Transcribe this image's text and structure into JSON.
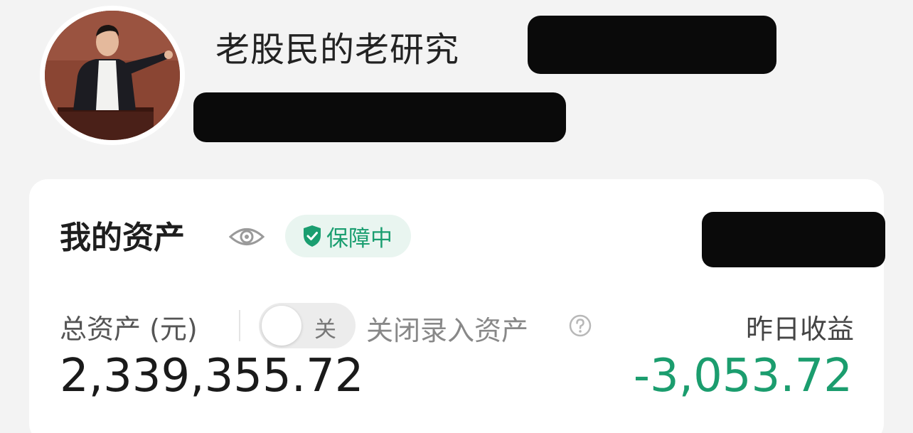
{
  "profile": {
    "username": "老股民的老研究"
  },
  "assets": {
    "title": "我的资产",
    "badge_label": "保障中",
    "total_label": "总资产 (元)",
    "toggle_label": "关",
    "toggle_state": "off",
    "close_entry_label": "关闭录入资产",
    "yesterday_label": "昨日收益",
    "total_value": "2,339,355.72",
    "yesterday_value": "-3,053.72"
  },
  "icons": {
    "eye": "eye-icon",
    "shield": "shield-check-icon",
    "help": "question-circle-icon"
  },
  "colors": {
    "accent_green": "#1a9e70",
    "badge_background": "#e9f5f0",
    "loss_green": "#1b9d6e",
    "page_background": "#f3f3f3"
  }
}
